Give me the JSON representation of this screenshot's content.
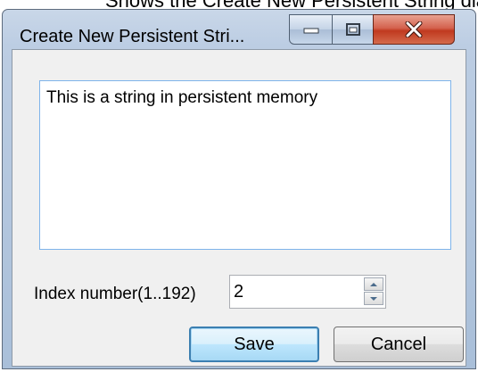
{
  "page_caption": "Shows the Create New Persistent String dialog",
  "window": {
    "title": "Create New Persistent Stri...",
    "minimize_icon": "minimize-icon",
    "maximize_icon": "maximize-icon",
    "close_icon": "close-icon"
  },
  "text_box": {
    "value": "This is a string in persistent memory"
  },
  "index": {
    "label": "Index number(1..192)",
    "value": "2",
    "up_icon": "spin-up-arrow-icon",
    "down_icon": "spin-down-arrow-icon"
  },
  "buttons": {
    "save": "Save",
    "cancel": "Cancel"
  },
  "colors": {
    "close_button": "#c7432b",
    "default_button_border": "#3c7fb1",
    "textbox_focus_border": "#7eb4ea"
  }
}
